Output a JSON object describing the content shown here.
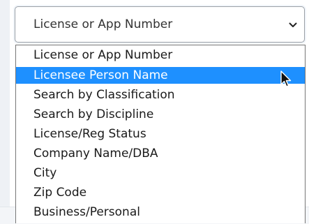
{
  "select": {
    "current_value": "License or App Number",
    "chevron_icon": "chevron-down-icon"
  },
  "dropdown": {
    "options": [
      {
        "label": "License or App Number",
        "selected": false
      },
      {
        "label": "Licensee Person Name",
        "selected": true
      },
      {
        "label": "Search by Classification",
        "selected": false
      },
      {
        "label": "Search by Discipline",
        "selected": false
      },
      {
        "label": "License/Reg Status",
        "selected": false
      },
      {
        "label": "Company Name/DBA",
        "selected": false
      },
      {
        "label": "City",
        "selected": false
      },
      {
        "label": "Zip Code",
        "selected": false
      },
      {
        "label": "Business/Personal",
        "selected": false
      }
    ],
    "highlight_color": "#1e90ff"
  },
  "cursor": {
    "icon": "mouse-pointer-icon"
  }
}
